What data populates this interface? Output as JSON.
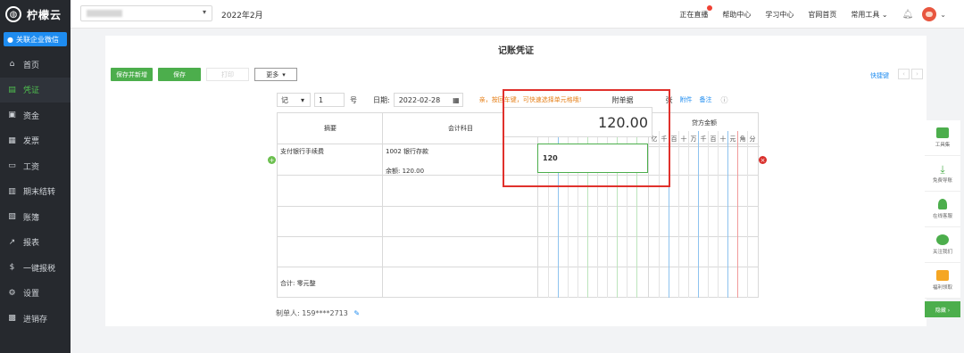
{
  "sidebar": {
    "logo_text": "柠檬云",
    "wechat_label": "关联企业微信",
    "items": [
      {
        "label": "首页",
        "icon": "home-icon"
      },
      {
        "label": "凭证",
        "icon": "document-icon"
      },
      {
        "label": "资金",
        "icon": "money-icon"
      },
      {
        "label": "发票",
        "icon": "invoice-icon"
      },
      {
        "label": "工资",
        "icon": "salary-icon"
      },
      {
        "label": "期末结转",
        "icon": "calendar-icon"
      },
      {
        "label": "账簿",
        "icon": "book-icon"
      },
      {
        "label": "报表",
        "icon": "chart-icon"
      },
      {
        "label": "一键报税",
        "icon": "tax-icon"
      },
      {
        "label": "设置",
        "icon": "settings-icon"
      },
      {
        "label": "进销存",
        "icon": "inventory-icon"
      }
    ]
  },
  "topbar": {
    "period": "2022年2月",
    "links": [
      "正在直播",
      "帮助中心",
      "学习中心",
      "官网首页",
      "常用工具"
    ]
  },
  "page": {
    "title": "记账凭证"
  },
  "toolbar": {
    "save_new": "保存并新增",
    "save": "保存",
    "print": "打印",
    "more": "更多",
    "shortcut": "快捷键"
  },
  "voucher_header": {
    "word": "记",
    "number": "1",
    "number_label": "号",
    "date_label": "日期:",
    "date": "2022-02-28",
    "tip": "亲，按回车键，可快速选择单元格哦!",
    "attachment_label": "附单据",
    "sheet_label": "张",
    "attachment_link": "附件",
    "note_link": "备注"
  },
  "table": {
    "col_summary": "摘要",
    "col_subject": "会计科目",
    "col_debit": "借方金额",
    "col_credit": "贷方金额",
    "units": [
      "亿",
      "千",
      "百",
      "十",
      "万",
      "千",
      "百",
      "十",
      "元",
      "角",
      "分"
    ],
    "row1": {
      "summary": "支付银行手续费",
      "subject": "1002 银行存款",
      "balance": "余额: 120.00",
      "debit_input": "120"
    },
    "popup_amount": "120.00",
    "total_label": "合计: 零元整"
  },
  "maker": {
    "label": "制单人: 159****2713"
  },
  "float_panel": {
    "items": [
      {
        "label": "工具集",
        "icon": "toolbox-icon"
      },
      {
        "label": "免费导账",
        "icon": "download-icon"
      },
      {
        "label": "在线客服",
        "icon": "service-icon"
      },
      {
        "label": "关注我们",
        "icon": "wechat-icon"
      },
      {
        "label": "福利领取",
        "icon": "gift-icon"
      }
    ],
    "collapse": "隐藏 ›"
  },
  "colors": {
    "sidebar_bg": "#26292e",
    "accent_green": "#4cae4c",
    "link_blue": "#1e8cf0",
    "highlight_red": "#e0312c"
  }
}
